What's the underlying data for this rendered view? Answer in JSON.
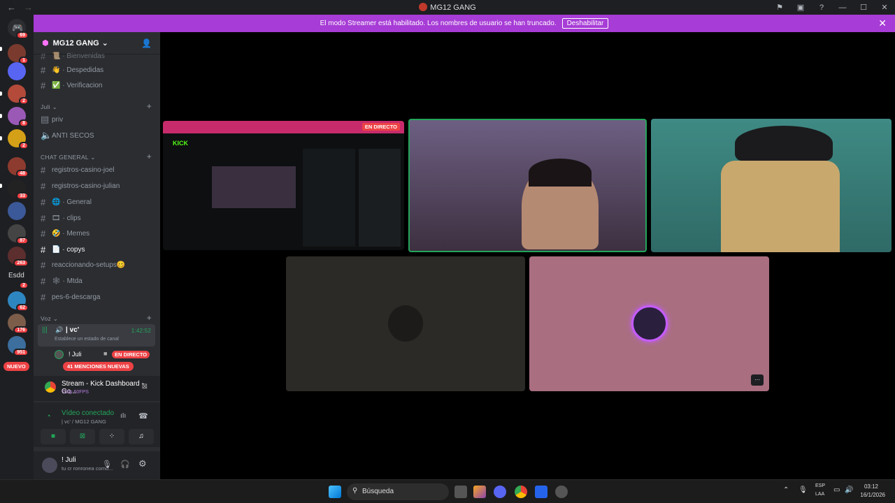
{
  "window": {
    "title": "MG12 GANG"
  },
  "banner": {
    "text": "El modo Streamer está habilitado. Los nombres de usuario se han truncado.",
    "button": "Deshabilitar"
  },
  "servers": [
    {
      "badge": "69"
    },
    {
      "badge": "1"
    },
    {
      "badge": ""
    },
    {
      "badge": "2"
    },
    {
      "badge": "8"
    },
    {
      "badge": "2"
    },
    {
      "badge": "48"
    },
    {
      "badge": "33"
    },
    {
      "badge": ""
    },
    {
      "badge": "87"
    },
    {
      "badge": "263"
    },
    {
      "badge": "2"
    },
    {
      "badge": "62"
    },
    {
      "badge": "176"
    },
    {
      "badge": "951"
    }
  ],
  "server_labels": {
    "esdd": "Esdd",
    "nuevo": "NUEVO"
  },
  "sidebar": {
    "server_name": "MG12 GANG",
    "channels_top": [
      {
        "name": "Bienvenidas",
        "emoji": "📜"
      },
      {
        "name": "Despedidas",
        "emoji": "👋"
      },
      {
        "name": "Verificacion",
        "emoji": "✅"
      }
    ],
    "cat_juli": "Juli",
    "juli_channels": [
      {
        "name": "priv"
      },
      {
        "name": "ANTI SECOS"
      }
    ],
    "cat_general": "CHAT GENERAL",
    "general_channels": [
      {
        "name": "registros-casino-joel"
      },
      {
        "name": "registros-casino-julian"
      },
      {
        "name": "General",
        "emoji": "🌐"
      },
      {
        "name": "clips",
        "emoji": "🎞"
      },
      {
        "name": "Memes",
        "emoji": "🤣"
      },
      {
        "name": "copys",
        "emoji": "📄"
      },
      {
        "name": "reaccionando-setups",
        "emoji": "🥴"
      },
      {
        "name": "Mtda",
        "emoji": "🕸"
      },
      {
        "name": "pes-6-descarga"
      }
    ],
    "cat_voz": "Voz",
    "voice_channel": {
      "name": "| vc'",
      "time": "1:42:52",
      "status": "Establece un estado de canal"
    },
    "voice_user": {
      "name": "! Juli",
      "live": "EN DIRECTO"
    },
    "mentions": "41 MENCIONES NUEVAS"
  },
  "activity": {
    "title": "Stream - Kick Dashboard - Go...",
    "sub": "720p 60FPS"
  },
  "connection": {
    "status": "Vídeo conectado",
    "channel": "| vc' / MG12 GANG"
  },
  "user": {
    "name": "! Juli",
    "status": "tu cr ronronea como..."
  },
  "stage": {
    "live_tag": "EN DIRECTO",
    "kick": "KICK",
    "more": "···"
  },
  "taskbar": {
    "search": "Búsqueda",
    "lang1": "ESP",
    "lang2": "LAA",
    "time": "03:12",
    "date": "16/1/2026"
  },
  "colors": {
    "accent": "#a73cd6",
    "live": "#ed4245",
    "speaking": "#23a55a",
    "connected": "#23a55a"
  }
}
